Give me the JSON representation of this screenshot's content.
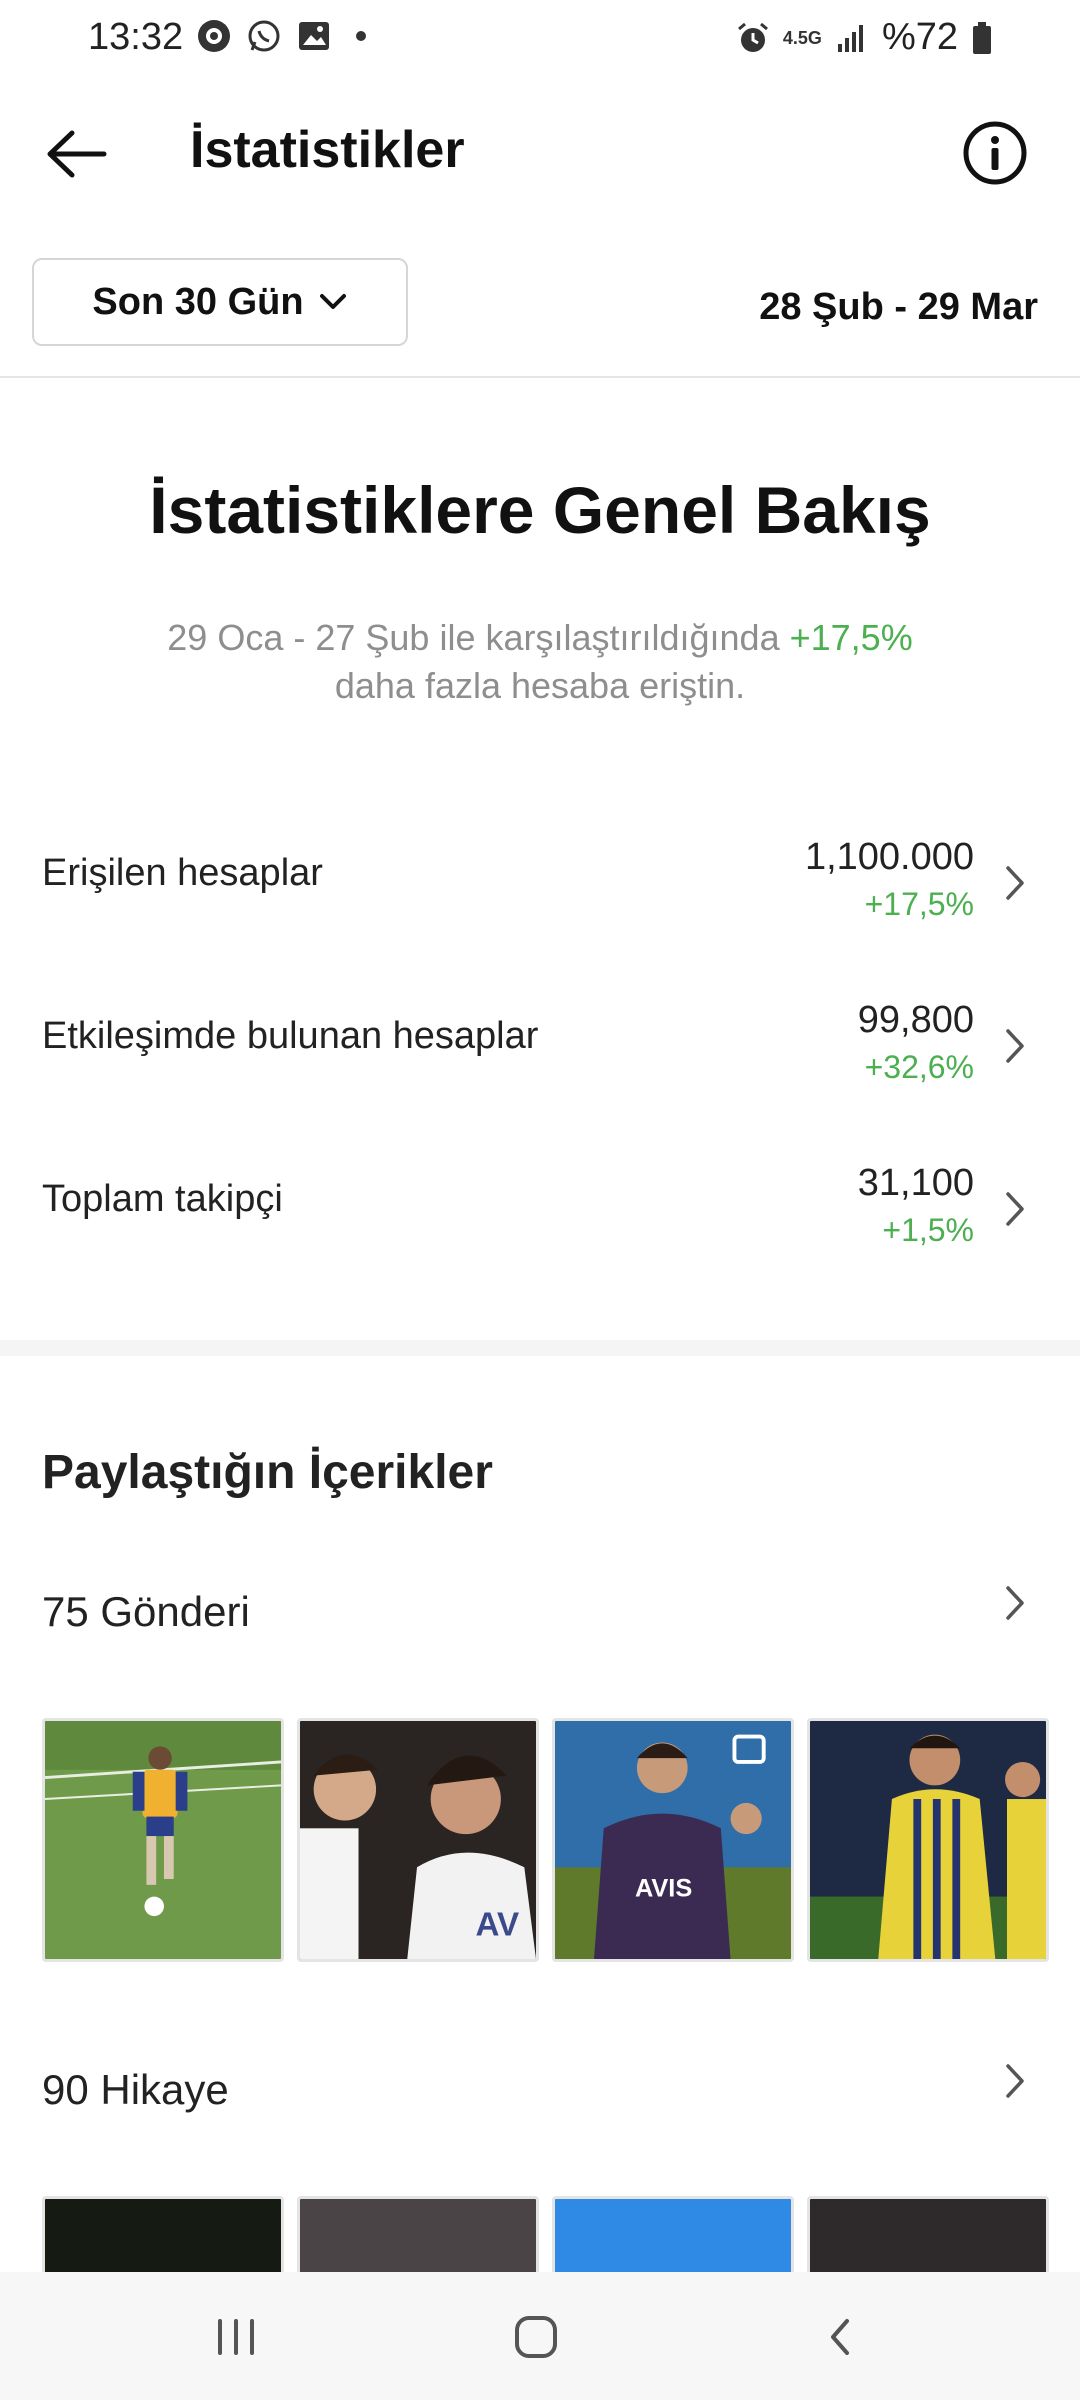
{
  "status_bar": {
    "time": "13:32",
    "network": "4.5G",
    "battery": "%72"
  },
  "header": {
    "title": "İstatistikler"
  },
  "filter": {
    "period_label": "Son 30 Gün",
    "date_range": "28 Şub - 29 Mar"
  },
  "overview": {
    "title": "İstatistiklere Genel Bakış",
    "subtitle_pre": "29 Oca - 27 Şub ile karşılaştırıldığında ",
    "subtitle_highlight": "+17,5%",
    "subtitle_post": "daha fazla hesaba eriştin."
  },
  "metrics": [
    {
      "label": "Erişilen hesaplar",
      "value": "1,100.000",
      "change": "+17,5%"
    },
    {
      "label": "Etkileşimde bulunan hesaplar",
      "value": "99,800",
      "change": "+32,6%"
    },
    {
      "label": "Toplam takipçi",
      "value": "31,100",
      "change": "+1,5%"
    }
  ],
  "content": {
    "title": "Paylaştığın İçerikler",
    "posts_label": "75 Gönderi",
    "stories_label": "90 Hikaye"
  },
  "colors": {
    "positive": "#4caf50",
    "muted": "#8e8e8e"
  }
}
